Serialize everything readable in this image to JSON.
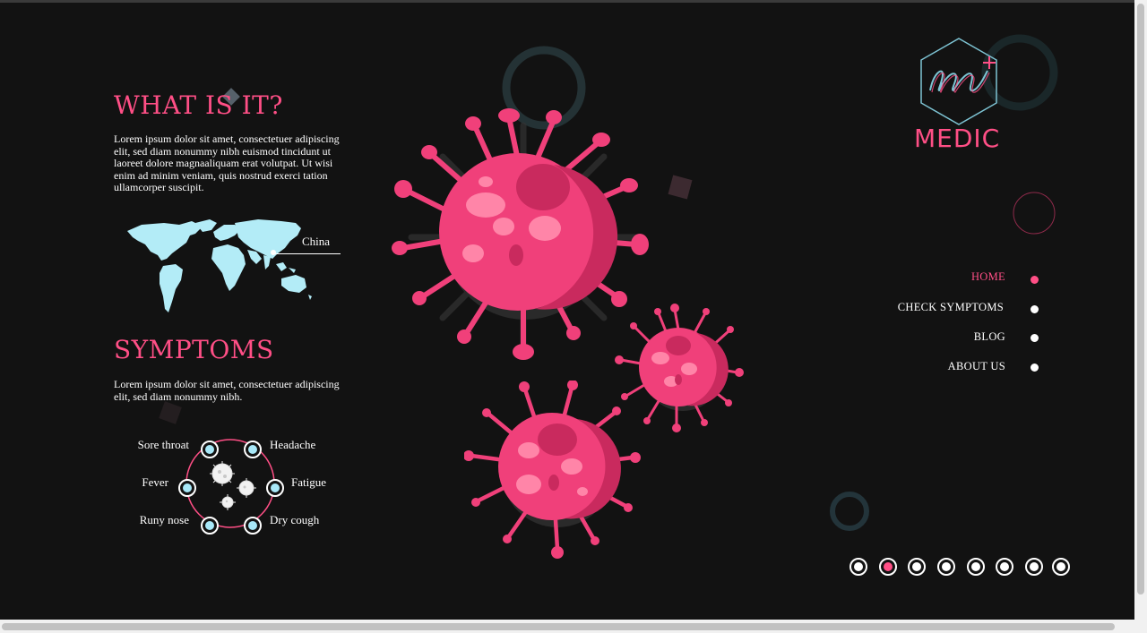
{
  "about": {
    "title": "WHAT IS IT?",
    "text": "Lorem ipsum dolor sit amet, consectetuer adipiscing elit, sed diam nonummy nibh euismod tincidunt ut laoreet dolore magnaaliquam erat volutpat. Ut wisi enim ad minim veniam, quis nostrud exerci tation ullamcorper suscipit."
  },
  "map": {
    "label": "China"
  },
  "symptoms": {
    "title": "SYMPTOMS",
    "text": "Lorem ipsum dolor sit amet, consectetuer adipiscing elit, sed diam nonummy nibh.",
    "items": [
      "Sore throat",
      "Headache",
      "Fever",
      "Fatigue",
      "Runy nose",
      "Dry cough"
    ]
  },
  "logo": {
    "text": "MEDIC"
  },
  "nav": {
    "items": [
      {
        "label": "HOME",
        "active": true
      },
      {
        "label": "CHECK SYMPTOMS",
        "active": false
      },
      {
        "label": "BLOG",
        "active": false
      },
      {
        "label": "ABOUT US",
        "active": false
      }
    ]
  },
  "pager": {
    "count": 8,
    "active_index": 1
  },
  "colors": {
    "accent": "#ff4f86",
    "background": "#121212",
    "map": "#b3ecf7",
    "virus": "#f0407a"
  },
  "icons": {
    "logo": "medic-hexagon-logo",
    "virus": "coronavirus-illustration",
    "map": "world-map"
  }
}
